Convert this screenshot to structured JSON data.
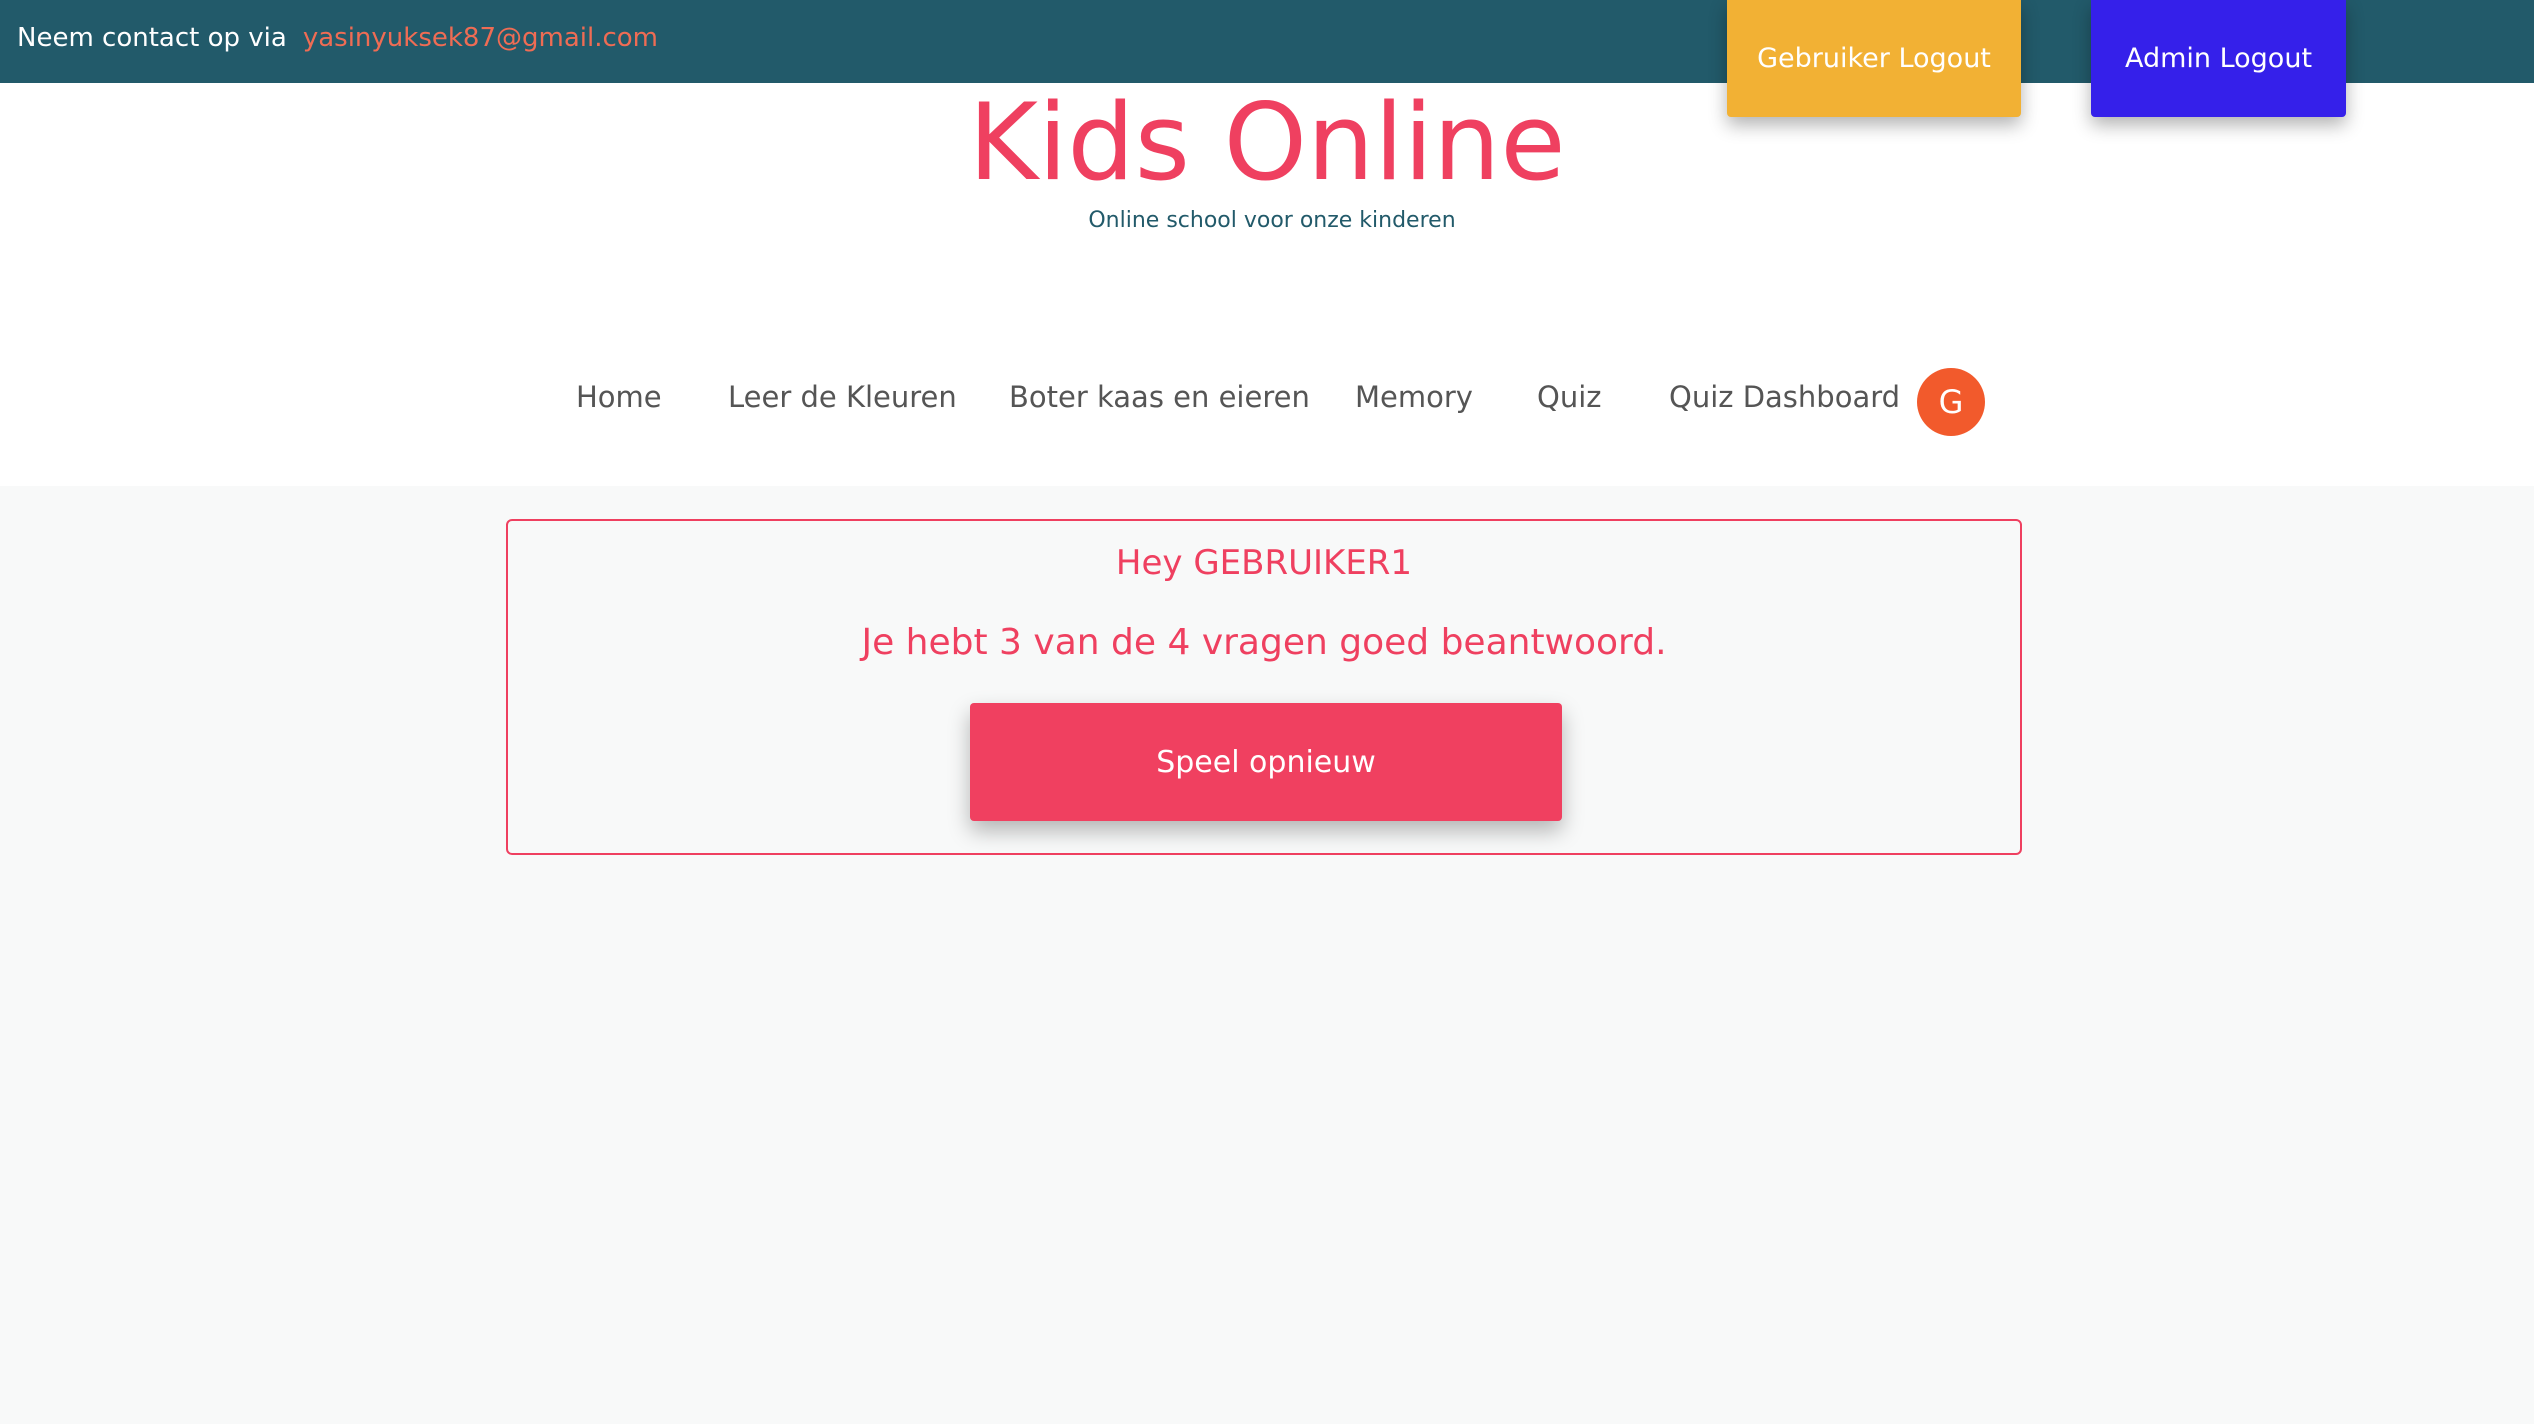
{
  "topbar": {
    "contact_label": "Neem contact op via",
    "contact_email": "yasinyuksek87@gmail.com",
    "user_logout_label": "Gebruiker Logout",
    "admin_logout_label": "Admin Logout"
  },
  "header": {
    "title": "Kids Online",
    "subtitle": "Online school voor onze kinderen"
  },
  "nav": {
    "items": [
      {
        "label": "Home"
      },
      {
        "label": "Leer de Kleuren"
      },
      {
        "label": "Boter kaas en eieren"
      },
      {
        "label": "Memory"
      },
      {
        "label": "Quiz"
      },
      {
        "label": "Quiz Dashboard"
      }
    ],
    "avatar_letter": "G"
  },
  "result": {
    "greeting": "Hey GEBRUIKER1",
    "score_text": "Je hebt 3 van de 4 vragen goed beantwoord.",
    "replay_label": "Speel opnieuw"
  },
  "colors": {
    "topbar": "#225a6a",
    "accent": "#ef4060",
    "email": "#ef6c54",
    "user_logout": "#f2b134",
    "admin_logout": "#3520ea",
    "avatar": "#f25a2c"
  }
}
